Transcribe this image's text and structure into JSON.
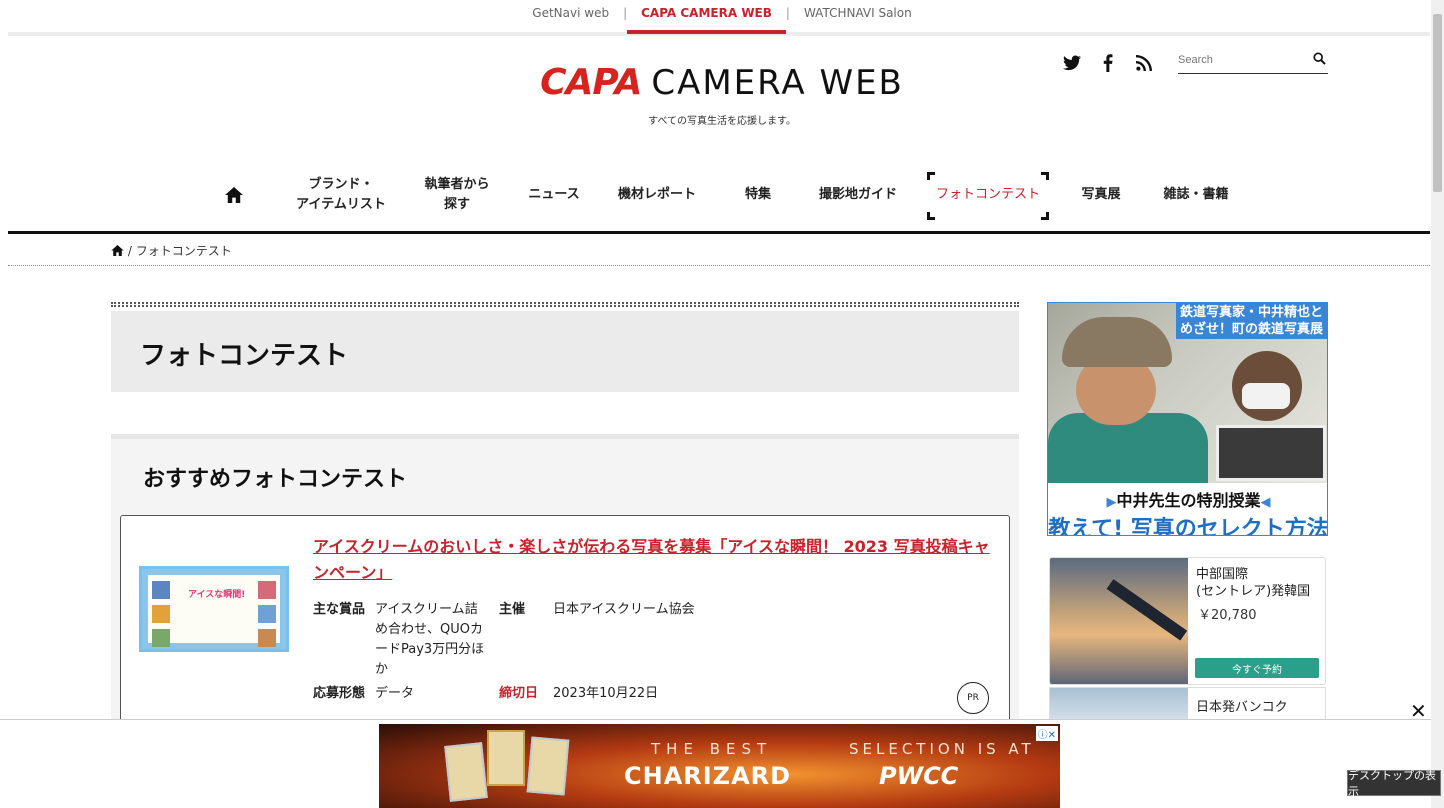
{
  "network": {
    "sites": [
      "GetNavi web",
      "CAPA CAMERA WEB",
      "WATCHNAVI Salon"
    ],
    "separator": "|"
  },
  "header": {
    "logo_mark": "CAPA",
    "logo_text": "CAMERA WEB",
    "tagline": "すべての写真生活を応援します。",
    "social": [
      "twitter-icon",
      "facebook-icon",
      "rss-icon"
    ],
    "search_placeholder": "Search"
  },
  "nav": {
    "items": [
      {
        "label": "ブランド・\nアイテムリスト"
      },
      {
        "label": "執筆者から\n探す"
      },
      {
        "label": "ニュース"
      },
      {
        "label": "機材レポート"
      },
      {
        "label": "特集"
      },
      {
        "label": "撮影地ガイド"
      },
      {
        "label": "フォトコンテスト"
      },
      {
        "label": "写真展"
      },
      {
        "label": "雑誌・書籍"
      }
    ],
    "active_index": 6
  },
  "breadcrumb": {
    "separator": "/",
    "current": "フォトコンテスト"
  },
  "main": {
    "page_title": "フォトコンテスト",
    "recommended": {
      "title": "おすすめフォトコンテスト",
      "card": {
        "title": "アイスクリームのおいしさ・楽しさが伝わる写真を募集「アイスな瞬間！ 2023 写真投稿キャンペーン」",
        "thumb_title": "アイスな瞬間!",
        "prize_label": "主な賞品",
        "prize_value": "アイスクリーム詰め合わせ、QUOカードPay3万円分ほか",
        "organizer_label": "主催",
        "organizer_value": "日本アイスクリーム協会",
        "entry_label": "応募形態",
        "entry_value": "データ",
        "deadline_label": "締切日",
        "deadline_value": "2023年10月22日",
        "pr": "PR"
      }
    }
  },
  "sidebar": {
    "ad1": {
      "tag_line1": "鉄道写真家・中井精也と",
      "tag_line2": "めざせ！町の鉄道写真展",
      "line1": "中井先生の特別授業",
      "line2": "教えて! 写真のセレクト方法"
    },
    "ad2": {
      "dest_line1": "中部国際",
      "dest_line2": "(セントレア)発韓国",
      "price": "￥20,780",
      "button": "今すぐ予約"
    },
    "ad3": {
      "dest": "日本発バンコク"
    }
  },
  "bottom_ad": {
    "line1_left": "THE BEST",
    "line1_right": "SELECTION IS AT",
    "line2_left": "CHARIZARD",
    "line2_right": "PWCC",
    "close": "✕"
  },
  "taskbar_tooltip": "デスクトップの表示"
}
